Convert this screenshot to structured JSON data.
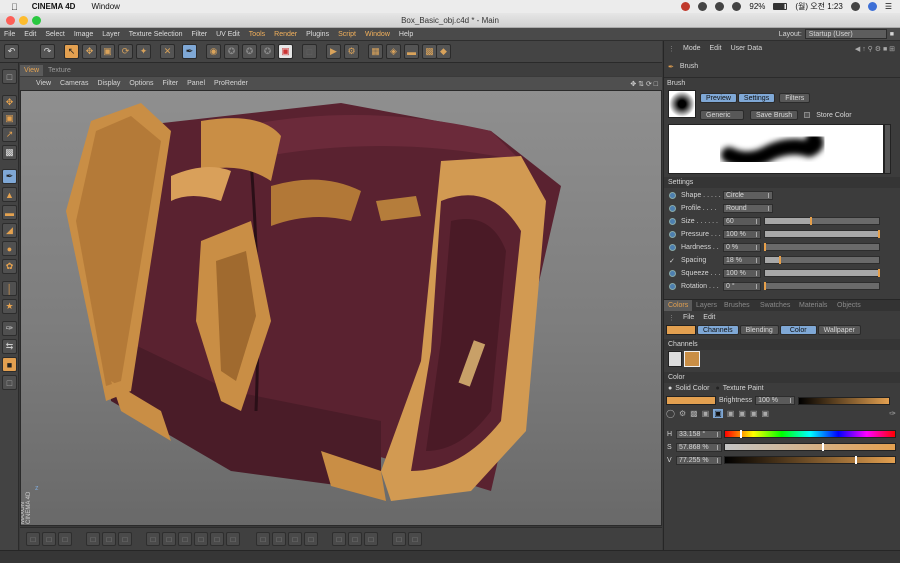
{
  "macos": {
    "app_name": "CINEMA 4D",
    "menu": "Window",
    "battery": "92%",
    "clock": "(월) 오전 1:23"
  },
  "window": {
    "title": "Box_Basic_obj.c4d * - Main"
  },
  "menubar": {
    "items": [
      "File",
      "Edit",
      "Select",
      "Image",
      "Layer",
      "Texture Selection",
      "Filter",
      "UV Edit",
      "Tools",
      "Render",
      "Plugins",
      "Script",
      "Window",
      "Help"
    ],
    "highlighted": [
      "Tools",
      "Render",
      "Script",
      "Window"
    ],
    "layout_label": "Layout:",
    "layout_value": "Startup (User)"
  },
  "viewport": {
    "tabs": [
      "View",
      "Texture"
    ],
    "active_tab": "View",
    "menu": [
      "View",
      "Cameras",
      "Display",
      "Options",
      "Filter",
      "Panel",
      "ProRender"
    ],
    "brand": "MAXON CINEMA 4D",
    "axis_label": "z"
  },
  "attributes": {
    "menu": [
      "Mode",
      "Edit",
      "User Data"
    ],
    "object_title": "Brush",
    "section_label": "Brush",
    "tabs": [
      "Preview",
      "Settings",
      "Filters"
    ],
    "preset": "Generic",
    "save_brush": "Save Brush",
    "store_color": "Store Color",
    "settings_label": "Settings",
    "params": [
      {
        "name": "Shape",
        "dots": " . . . . .",
        "value": "Circle",
        "kind": "dropdown"
      },
      {
        "name": "Profile",
        "dots": " . . . .",
        "value": "Round",
        "kind": "dropdown"
      },
      {
        "name": "Size",
        "dots": " . . . . . .",
        "value": "60",
        "kind": "slider",
        "level": 0.4
      },
      {
        "name": "Pressure",
        "dots": " . . .",
        "value": "100 %",
        "kind": "slider",
        "level": 1.0
      },
      {
        "name": "Hardness",
        "dots": " . .",
        "value": "0 %",
        "kind": "slider",
        "level": 0.0
      },
      {
        "name": "Spacing",
        "dots": "",
        "value": "18 %",
        "kind": "slider",
        "level": 0.13
      },
      {
        "name": "Squeeze",
        "dots": " . . .",
        "value": "100 %",
        "kind": "slider",
        "level": 1.0
      },
      {
        "name": "Rotation",
        "dots": " . . .",
        "value": "0 °",
        "kind": "slider",
        "level": 0.0
      }
    ]
  },
  "colors_panel": {
    "tabs": [
      "Colors",
      "Layers",
      "Brushes",
      "Swatches",
      "Materials",
      "Objects"
    ],
    "active_tab": "Colors",
    "menu": [
      "File",
      "Edit"
    ],
    "mode_tabs": [
      "Channels",
      "Blending",
      "Color",
      "Wallpaper"
    ],
    "channels_label": "Channels",
    "color_label": "Color",
    "solid_color": "Solid Color",
    "texture_paint": "Texture Paint",
    "brightness_label": "Brightness",
    "brightness_value": "100 %",
    "swatch_color": "#e3a050",
    "hsv": [
      {
        "label": "H",
        "value": "33.158 °",
        "level": 0.092
      },
      {
        "label": "S",
        "value": "57.868 %",
        "level": 0.579
      },
      {
        "label": "V",
        "value": "77.255 %",
        "level": 0.773
      }
    ]
  },
  "colors": {
    "accent": "#e3a050",
    "wood": "#5a2230",
    "highlight": "#7fa8d6"
  }
}
